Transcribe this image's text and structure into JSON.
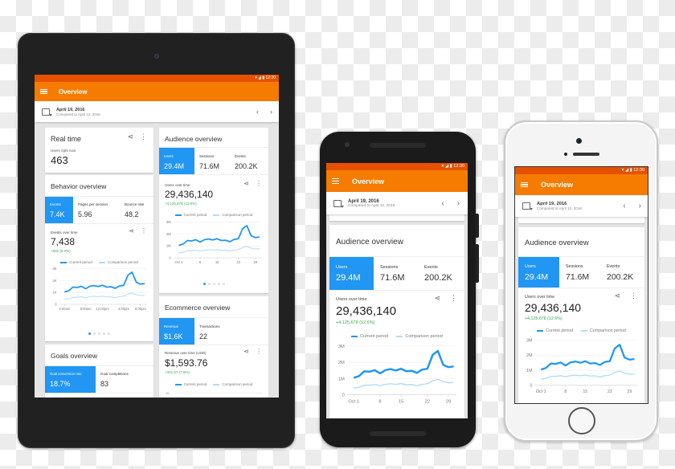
{
  "status_bar": {
    "time": "12:30",
    "icons": [
      "wifi-icon",
      "signal-icon",
      "battery-icon"
    ]
  },
  "app_bar": {
    "title": "Overview",
    "menu_icon": "hamburger-menu-icon"
  },
  "date_bar": {
    "date": "April 19, 2016",
    "compared": "Compared to April 12, 2016",
    "prev": "‹",
    "next": "›"
  },
  "legend": {
    "current": "Current period",
    "comparison": "Comparison period"
  },
  "colors": {
    "accent": "#f57c00",
    "status": "#e65100",
    "selected": "#2196f3",
    "current_line": "#2196f3",
    "comparison_line": "#b3dcf9",
    "delta": "#34a853"
  },
  "realtime": {
    "title": "Real time",
    "label": "Users right now",
    "value": "463"
  },
  "behavior": {
    "title": "Behavior overview",
    "metrics": [
      {
        "label": "Events",
        "value": "7.4K"
      },
      {
        "label": "Pages per session",
        "value": "5.96"
      },
      {
        "label": "Bounce rate",
        "value": "48.2"
      }
    ],
    "chart_title": "Events over time",
    "total": "7,438",
    "delta": "+932 (8.2%)"
  },
  "audience": {
    "title": "Audience overview",
    "metrics": [
      {
        "label": "Users",
        "value": "29.4M"
      },
      {
        "label": "Sessions",
        "value": "71.6M"
      },
      {
        "label": "Events",
        "value": "200.2K"
      }
    ],
    "chart_title": "Users over time",
    "total": "29,436,140",
    "delta": "+4,125,678 (12.6%)"
  },
  "ecommerce": {
    "title": "Ecommerce overview",
    "metrics": [
      {
        "label": "Revenue",
        "value": "$1.6K"
      },
      {
        "label": "Transactions",
        "value": "22"
      }
    ],
    "chart_title": "Revenue over time (USD)",
    "total": "$1,593.76",
    "delta": "+321.67 (7.6%)",
    "ytick_top": "2K"
  },
  "goals": {
    "title": "Goals overview",
    "metrics": [
      {
        "label": "Goal conversion rate",
        "value": "18.7%"
      },
      {
        "label": "Goal completions",
        "value": "83"
      }
    ]
  },
  "chart_data": [
    {
      "type": "line",
      "title": "Events over time",
      "categories": [
        "4:00am",
        "8:00am",
        "12:00pm",
        "4:00pm",
        "8:00pm"
      ],
      "yticks": [
        "0",
        "1K",
        "2K",
        "3K"
      ],
      "ylim": [
        0,
        3000
      ],
      "series": [
        {
          "name": "Current period",
          "values": [
            1050,
            1150,
            1450,
            1420,
            1520,
            1320,
            1520,
            1580,
            1500,
            1600,
            1450,
            1480,
            1350,
            1550,
            1600,
            2450,
            2700,
            1850,
            1700,
            1750
          ]
        },
        {
          "name": "Comparison period",
          "values": [
            420,
            460,
            600,
            590,
            640,
            560,
            640,
            680,
            640,
            690,
            620,
            630,
            560,
            640,
            680,
            860,
            950,
            820,
            740,
            760
          ]
        }
      ]
    },
    {
      "type": "line",
      "title": "Users over time",
      "categories": [
        "Oct 1",
        "8",
        "15",
        "22",
        "29"
      ],
      "yticks": [
        "0",
        "1M",
        "2M",
        "3M"
      ],
      "ylim": [
        0,
        3000000
      ],
      "series": [
        {
          "name": "Current period",
          "values": [
            1050000,
            1150000,
            1450000,
            1420000,
            1520000,
            1320000,
            1520000,
            1580000,
            1500000,
            1600000,
            1450000,
            1480000,
            1350000,
            1550000,
            1600000,
            2450000,
            2700000,
            1850000,
            1700000,
            1750000
          ]
        },
        {
          "name": "Comparison period",
          "values": [
            420000,
            460000,
            600000,
            590000,
            640000,
            560000,
            640000,
            680000,
            640000,
            690000,
            620000,
            630000,
            560000,
            640000,
            680000,
            860000,
            950000,
            820000,
            740000,
            760000
          ]
        }
      ]
    }
  ]
}
